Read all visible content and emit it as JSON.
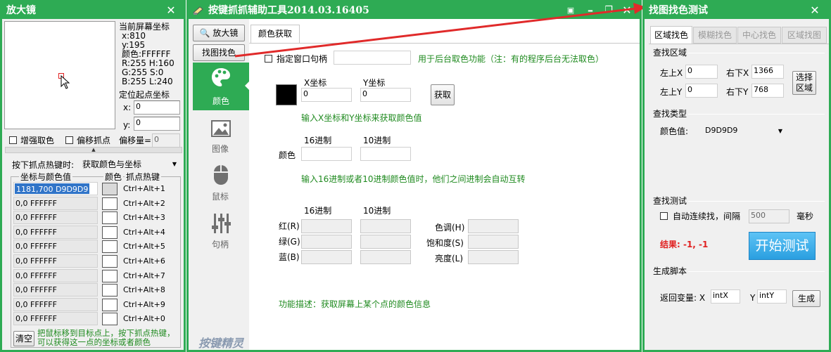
{
  "left": {
    "title": "放大镜",
    "close": "✕",
    "coords_label": "当前屏幕坐标",
    "x": "x:810",
    "y": "y:195",
    "color": "颜色:FFFFFF",
    "rh": "R:255  H:160",
    "gs": "G:255  S:0",
    "bl": "B:255  L:240",
    "origin_label": "定位起点坐标",
    "ox_label": "x:",
    "ox_value": "0",
    "oy_label": "y:",
    "oy_value": "0",
    "enhance": "增强取色",
    "offset": "偏移抓点",
    "offset_amount_label": "偏移量=",
    "offset_amount": "0",
    "hotkey_label": "按下抓点热键时:",
    "hotkey_select": "获取颜色与坐标",
    "col_coord": "坐标与颜色值",
    "col_color": "颜色",
    "col_hotkey": "抓点热键",
    "rows": [
      {
        "value": "1181,700  D9D9D9",
        "hotkey": "Ctrl+Alt+1",
        "swatch": "#d9d9d9"
      },
      {
        "value": "0,0  FFFFFF",
        "hotkey": "Ctrl+Alt+2",
        "swatch": "#ffffff"
      },
      {
        "value": "0,0  FFFFFF",
        "hotkey": "Ctrl+Alt+3",
        "swatch": "#ffffff"
      },
      {
        "value": "0,0  FFFFFF",
        "hotkey": "Ctrl+Alt+4",
        "swatch": "#ffffff"
      },
      {
        "value": "0,0  FFFFFF",
        "hotkey": "Ctrl+Alt+5",
        "swatch": "#ffffff"
      },
      {
        "value": "0,0  FFFFFF",
        "hotkey": "Ctrl+Alt+6",
        "swatch": "#ffffff"
      },
      {
        "value": "0,0  FFFFFF",
        "hotkey": "Ctrl+Alt+7",
        "swatch": "#ffffff"
      },
      {
        "value": "0,0  FFFFFF",
        "hotkey": "Ctrl+Alt+8",
        "swatch": "#ffffff"
      },
      {
        "value": "0,0  FFFFFF",
        "hotkey": "Ctrl+Alt+9",
        "swatch": "#ffffff"
      },
      {
        "value": "0,0  FFFFFF",
        "hotkey": "Ctrl+Alt+0",
        "swatch": "#ffffff"
      }
    ],
    "clear": "清空",
    "hint": "把鼠标移到目标点上，按下抓点热键，可以获得这一点的坐标或者颜色"
  },
  "mid": {
    "title": "按键抓抓辅助工具2014.03.16405",
    "side": {
      "magnifier": "放大镜",
      "findpic": "找图找色",
      "color": "颜色",
      "image": "图像",
      "mouse": "鼠标",
      "handle": "句柄",
      "logo": "按键精灵"
    },
    "tab": "颜色获取",
    "win_handle": "指定窗口句柄",
    "win_handle_hint": "用于后台取色功能（注：有的程序后台无法取色）",
    "xlabel": "X坐标",
    "ylabel": "Y坐标",
    "xval": "0",
    "yval": "0",
    "get_btn": "获取",
    "hint1": "输入X坐标和Y坐标来获取颜色值",
    "hex": "16进制",
    "dec": "10进制",
    "color_label": "颜色",
    "hint2": "输入16进制或者10进制颜色值时，他们之间进制会自动互转",
    "hex2": "16进制",
    "dec2": "10进制",
    "red": "红(R)",
    "green": "绿(G)",
    "blue": "蓝(B)",
    "hue": "色调(H)",
    "sat": "饱和度(S)",
    "lum": "亮度(L)",
    "desc": "功能描述：获取屏幕上某个点的颜色信息"
  },
  "right": {
    "title": "找图找色测试",
    "close": "✕",
    "tabs": [
      "区域找色",
      "模糊找色",
      "中心找色",
      "区域找图"
    ],
    "area_label": "查找区域",
    "lx": "左上X",
    "lx_val": "0",
    "rx": "右下X",
    "rx_val": "1366",
    "ly": "左上Y",
    "ly_val": "0",
    "ry": "右下Y",
    "ry_val": "768",
    "select_btn": "选择区域",
    "type_label": "查找类型",
    "color_val_label": "颜色值:",
    "color_val": "D9D9D9",
    "test_label": "查找测试",
    "auto": "自动连续找，间隔",
    "interval": "500",
    "ms": "毫秒",
    "result": "结果: -1, -1",
    "start_btn": "开始测试",
    "script_label": "生成脚本",
    "ret_label": "返回变量: X",
    "ret_x": "intX",
    "ret_y_label": "Y",
    "ret_y": "intY",
    "gen_btn": "生成"
  },
  "colors": {
    "accent": "#2eab54",
    "result": "#e02020",
    "start_btn": "#39a9e8"
  }
}
